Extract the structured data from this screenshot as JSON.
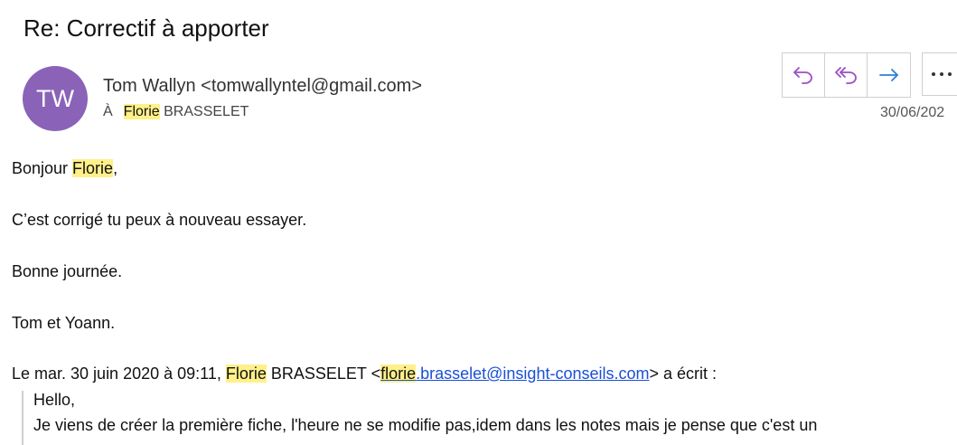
{
  "subject": "Re: Correctif à apporter",
  "sender": {
    "initials": "TW",
    "display": "Tom Wallyn <tomwallyntel@gmail.com>",
    "avatar_color": "#8a63b8"
  },
  "recipient": {
    "label": "À",
    "first_name": "Florie",
    "last_name": " BRASSELET"
  },
  "date": "30/06/202",
  "actions": {
    "reply_icon": "reply-icon",
    "reply_all_icon": "reply-all-icon",
    "forward_icon": "forward-icon",
    "more_icon": "more-icon"
  },
  "body": {
    "greeting_prefix": "Bonjour ",
    "greeting_name": "Florie",
    "greeting_suffix": ",",
    "line1": "C’est corrigé tu peux à nouveau essayer.",
    "line2": "Bonne journée.",
    "signature": "Tom et Yoann."
  },
  "quote_header": {
    "prefix": "Le mar. 30 juin 2020 à 09:11, ",
    "name": "Florie",
    "name_rest": " BRASSELET <",
    "email_hl": "florie",
    "email_rest": ".brasselet@insight-conseils.com",
    "suffix": "> a écrit :"
  },
  "quote": {
    "line1": "Hello,",
    "line2": "Je viens de créer la première fiche, l'heure ne se modifie pas,idem dans les notes mais je pense que c'est un"
  },
  "colors": {
    "highlight": "#fff08a",
    "link": "#1a4fd6",
    "reply_purple": "#9b4fc4",
    "forward_blue": "#2b7fd6"
  }
}
